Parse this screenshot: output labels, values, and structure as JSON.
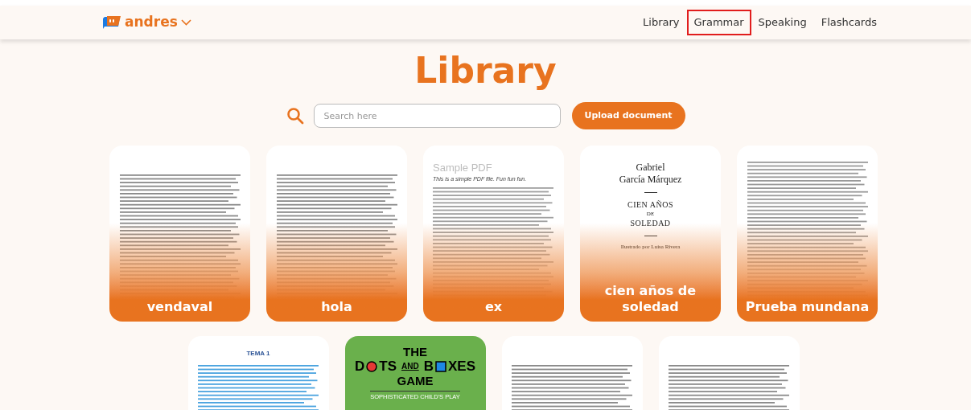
{
  "header": {
    "brand": "andres",
    "nav": [
      {
        "label": "Library",
        "selected": false
      },
      {
        "label": "Grammar",
        "selected": true
      },
      {
        "label": "Speaking",
        "selected": false
      },
      {
        "label": "Flashcards",
        "selected": false
      }
    ]
  },
  "title": "Library",
  "search": {
    "placeholder": "Search here"
  },
  "upload_button": "Upload document",
  "documents": [
    {
      "title": "vendaval",
      "preview": {
        "kind": "text"
      }
    },
    {
      "title": "hola",
      "preview": {
        "kind": "text"
      }
    },
    {
      "title": "ex",
      "preview": {
        "kind": "sample",
        "heading": "Sample PDF",
        "subtitle": "This is a simple PDF file. Fun fun fun."
      }
    },
    {
      "title": "cien años de soledad",
      "preview": {
        "kind": "cover",
        "author": [
          "Gabriel",
          "García Márquez"
        ],
        "book": [
          "CIEN AÑOS",
          "DE",
          "SOLEDAD"
        ],
        "credit": "Ilustrado por Luisa Rivera"
      }
    },
    {
      "title": "Prueba mundana",
      "preview": {
        "kind": "outline"
      }
    },
    {
      "preview": {
        "kind": "tema",
        "heading": "TEMA 1"
      }
    },
    {
      "preview": {
        "kind": "game",
        "top": "THE",
        "parts": [
          "D",
          "TS",
          "AND",
          "B",
          "XES"
        ],
        "bottom": "GAME",
        "tagline": "SOPHISTICATED CHILD'S PLAY"
      }
    },
    {
      "preview": {
        "kind": "text"
      }
    },
    {
      "preview": {
        "kind": "text"
      }
    }
  ]
}
